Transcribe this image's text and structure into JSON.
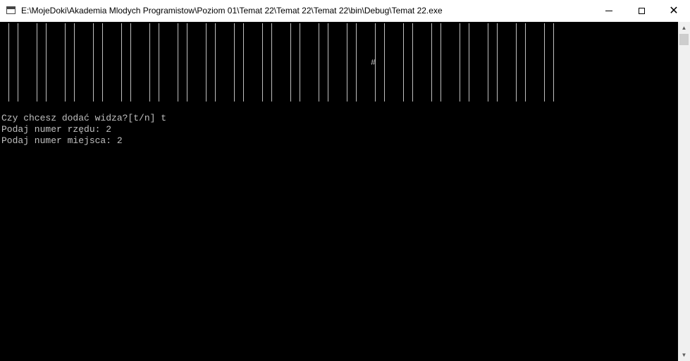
{
  "window": {
    "title": "E:\\MojeDoki\\Akademia Mlodych Programistow\\Poziom 01\\Temat 22\\Temat 22\\Temat 22\\bin\\Debug\\Temat 22.exe",
    "icon": "console-app-icon",
    "minimize_glyph": "",
    "maximize_glyph": "",
    "close_glyph": "✕"
  },
  "console": {
    "seat_grid": {
      "rows": 7,
      "columns": 20,
      "marker": "#",
      "marked_row": 4,
      "marked_column": 14
    },
    "lines": [
      "Czy chcesz dodać widza?[t/n] t",
      "Podaj numer rzędu: 2",
      "Podaj numer miejsca: 2"
    ],
    "text_color": "#c0c0c0",
    "background": "#000000"
  },
  "scrollbar": {
    "up_arrow": "▲",
    "down_arrow": "▼"
  }
}
